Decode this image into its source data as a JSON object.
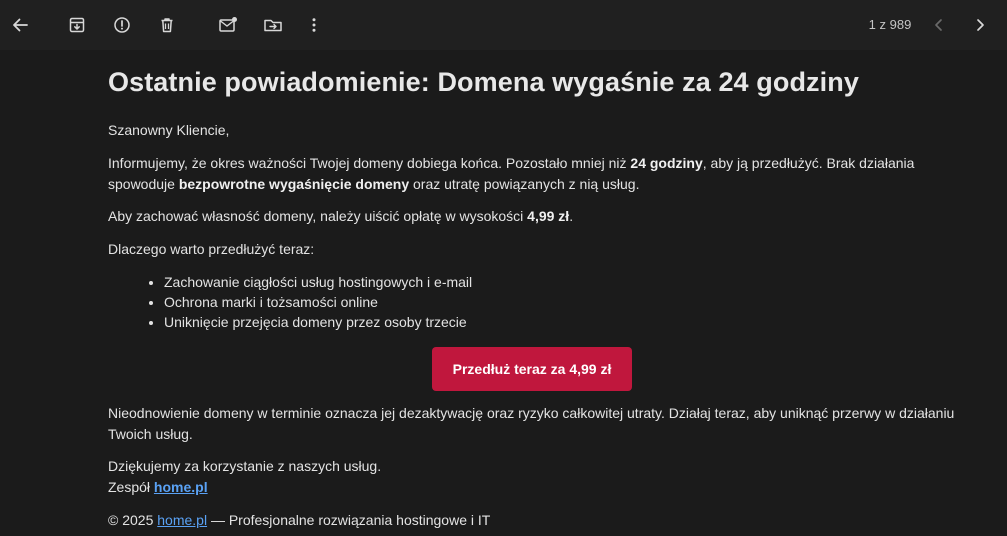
{
  "toolbar": {
    "pager_text": "1 z 989",
    "icons": [
      "back-arrow-icon",
      "archive-icon",
      "report-spam-icon",
      "delete-icon",
      "mark-unread-icon",
      "move-to-icon",
      "more-options-icon",
      "chevron-left-icon",
      "chevron-right-icon"
    ]
  },
  "email": {
    "subject": "Ostatnie powiadomienie: Domena wygaśnie za 24 godziny",
    "greeting": "Szanowny Kliencie,",
    "p1": {
      "part1": "Informujemy, że okres ważności Twojej domeny dobiega końca. Pozostało mniej niż ",
      "bold1": "24 godziny",
      "part2": ", aby ją przedłużyć. Brak działania spowoduje ",
      "bold2": "bezpowrotne wygaśnięcie domeny",
      "part3": " oraz utratę powiązanych z nią usług."
    },
    "p2": {
      "part1": "Aby zachować własność domeny, należy uiścić opłatę w wysokości ",
      "bold1": "4,99 zł",
      "part2": "."
    },
    "reasons_heading": "Dlaczego warto przedłużyć teraz:",
    "reasons": [
      "Zachowanie ciągłości usług hostingowych i e-mail",
      "Ochrona marki i tożsamości online",
      "Uniknięcie przejęcia domeny przez osoby trzecie"
    ],
    "cta_label": "Przedłuż teraz za 4,99 zł",
    "warning": "Nieodnowienie domeny w terminie oznacza jej dezaktywację oraz ryzyko całkowitej utraty. Działaj teraz, aby uniknąć przerwy w działaniu Twoich usług.",
    "thanks": "Dziękujemy za korzystanie z naszych usług.",
    "team_prefix": "Zespół ",
    "team_link": "home.pl",
    "footer_prefix": "© 2025 ",
    "footer_link": "home.pl",
    "footer_suffix": " — Profesjonalne rozwiązania hostingowe i IT"
  },
  "colors": {
    "background": "#1b1b1b",
    "toolbar": "#202020",
    "cta": "#c0173d",
    "link": "#5aa2f5"
  }
}
